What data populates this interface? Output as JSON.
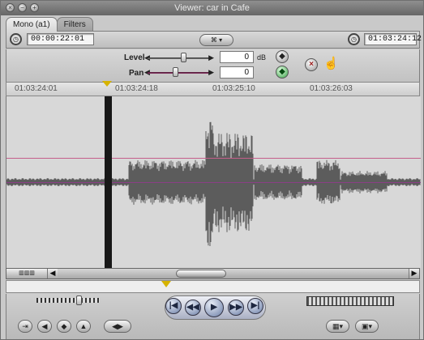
{
  "window": {
    "title": "Viewer: car in Cafe",
    "close_glyph": "×",
    "minimize_glyph": "−",
    "zoom_glyph": "+"
  },
  "tabs": [
    {
      "label": "Mono (a1)"
    },
    {
      "label": "Filters"
    }
  ],
  "header": {
    "duration": "00:00:22:01",
    "current_timecode": "01:03:24:12",
    "clip_button": "⌘ ▾"
  },
  "controls": {
    "level_label": "Level",
    "level_value": "0",
    "level_unit": "dB",
    "pan_label": "Pan",
    "pan_value": "0",
    "level_slider_fraction": 0.58,
    "pan_slider_fraction": 0.42
  },
  "ruler": {
    "timecodes": [
      "01:03:24:01",
      "01:03:24:18",
      "01:03:25:10",
      "01:03:26:03"
    ]
  },
  "audio": {
    "level_line": 0.36,
    "pan_line": 0.5
  },
  "icons": {
    "clock": "◷",
    "diamond": "◆",
    "close": "×",
    "hand": "☝",
    "left_arrow": "◀",
    "right_arrow": "▶",
    "play": "▶"
  },
  "transport": {
    "buttons": [
      "|◀",
      "◀◀",
      "▶",
      "▶▶",
      "▶|"
    ]
  },
  "bottom_controls": {
    "left_buttons": [
      "⇥",
      "◀",
      "◆",
      "▲",
      "◀▶"
    ],
    "right_buttons": [
      "▦▾",
      "▣▾"
    ]
  }
}
